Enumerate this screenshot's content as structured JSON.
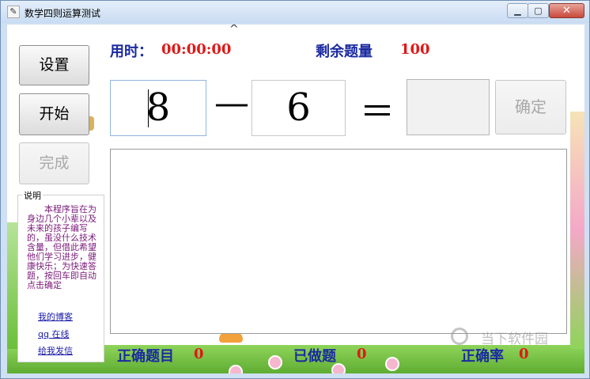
{
  "window": {
    "title": "数学四则运算测试",
    "icon": "app-icon",
    "controls": {
      "minimize": "minimize-icon",
      "maximize": "maximize-icon",
      "close": "close-icon"
    }
  },
  "sidebar": {
    "settings_label": "设置",
    "start_label": "开始",
    "finish_label": "完成",
    "info": {
      "legend": "说明",
      "text": "本程序旨在为身边几个小辈以及未来的孩子编写的，虽没什么技术含量，但借此希望他们学习进步，健康快乐；为快速答题，按回车即自动点击确定",
      "links": [
        "我的博客",
        "qq 在线",
        "给我发信"
      ]
    }
  },
  "status_top": {
    "time_label": "用时：",
    "time_value": "00:00:00",
    "remaining_label": "剩余题量",
    "remaining_value": "100"
  },
  "question": {
    "operand1": "8",
    "operator": "—",
    "operand2": "6",
    "equals": "＝",
    "answer": "",
    "confirm_label": "确定"
  },
  "status_bottom": {
    "correct_label": "正确题目",
    "correct_value": "0",
    "done_label": "已做题",
    "done_value": "0",
    "rate_label": "正确率",
    "rate_value": "0"
  },
  "watermark": {
    "text": "当下软件园"
  },
  "colors": {
    "label_blue": "#1a2aa0",
    "value_red": "#e01818",
    "info_purple": "#7a1a7a"
  }
}
